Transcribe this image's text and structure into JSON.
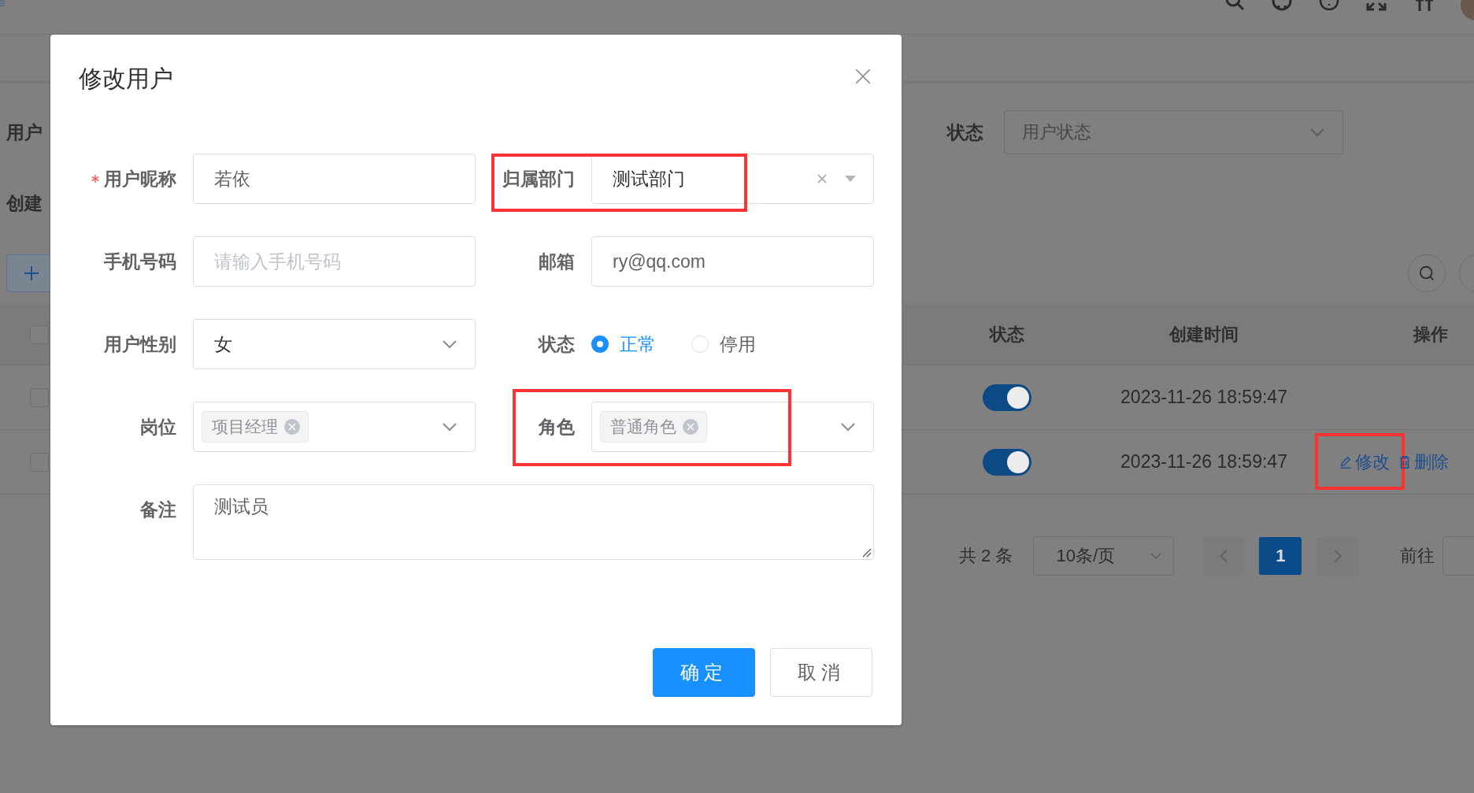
{
  "background": {
    "search_form": {
      "left_labels": [
        "用户",
        "创建"
      ],
      "status_label": "状态",
      "status_placeholder": "用户状态"
    },
    "table": {
      "header_checked": false,
      "columns": [
        "状态",
        "创建时间",
        "操作"
      ],
      "rows": [
        {
          "checked": false,
          "on": true,
          "created": "2023-11-26 18:59:47",
          "actions": []
        },
        {
          "checked": false,
          "on": true,
          "created": "2023-11-26 18:59:47",
          "actions": [
            {
              "kind": "edit",
              "label": "修改",
              "highlighted": true
            },
            {
              "kind": "delete",
              "label": "删除",
              "highlighted": false
            }
          ]
        }
      ]
    },
    "pagination": {
      "total": "共 2 条",
      "page_size": "10条/页",
      "pages": [
        {
          "label": "1",
          "selected": true
        }
      ],
      "goto_label": "前往"
    }
  },
  "dialog": {
    "title": "修改用户",
    "fields": [
      {
        "kind": "text",
        "label": "用户昵称",
        "required": true,
        "highlighted": false,
        "value": "若依"
      },
      {
        "kind": "tree_select",
        "label": "归属部门",
        "required": false,
        "highlighted": true,
        "value": "测试部门"
      },
      {
        "kind": "text",
        "label": "手机号码",
        "required": false,
        "highlighted": false,
        "placeholder": "请输入手机号码"
      },
      {
        "kind": "text",
        "label": "邮箱",
        "required": false,
        "highlighted": false,
        "value": "ry@qq.com"
      },
      {
        "kind": "select",
        "label": "用户性别",
        "required": false,
        "highlighted": false,
        "value": "女"
      },
      {
        "kind": "radio",
        "label": "状态",
        "required": false,
        "highlighted": false,
        "options": [
          {
            "label": "正常",
            "selected": true
          },
          {
            "label": "停用",
            "selected": false
          }
        ]
      },
      {
        "kind": "multi_select",
        "label": "岗位",
        "required": false,
        "highlighted": false,
        "tags": [
          "项目经理"
        ]
      },
      {
        "kind": "multi_select",
        "label": "角色",
        "required": false,
        "highlighted": true,
        "tags": [
          "普通角色"
        ]
      },
      {
        "kind": "textarea",
        "label": "备注",
        "required": false,
        "highlighted": false,
        "value": "测试员"
      }
    ],
    "buttons": [
      {
        "kind": "primary",
        "label": "确定"
      },
      {
        "kind": "default",
        "label": "取消"
      }
    ]
  }
}
